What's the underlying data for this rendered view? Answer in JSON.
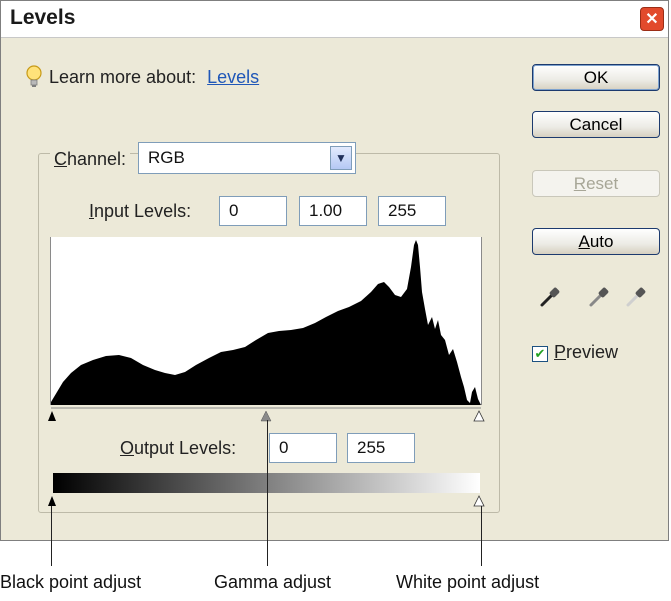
{
  "window": {
    "title": "Levels",
    "close_icon": "close-icon"
  },
  "learn": {
    "prefix": "Learn more about:",
    "link": "Levels",
    "icon": "lightbulb-icon"
  },
  "buttons": {
    "ok": "OK",
    "cancel": "Cancel",
    "reset": "Reset",
    "auto": "Auto"
  },
  "channel": {
    "label": "Channel:",
    "value": "RGB"
  },
  "input_levels": {
    "label": "Input Levels:",
    "black": "0",
    "gamma": "1.00",
    "white": "255"
  },
  "output_levels": {
    "label": "Output Levels:",
    "black": "0",
    "white": "255"
  },
  "preview": {
    "label": "Preview",
    "checked": true
  },
  "eyedroppers": [
    "black-eyedropper-icon",
    "gray-eyedropper-icon",
    "white-eyedropper-icon"
  ],
  "callouts": {
    "black": "Black point adjust",
    "gamma": "Gamma adjust",
    "white": "White point adjust"
  },
  "colors": {
    "dialog_bg": "#ece9d8",
    "link": "#1f57b8",
    "close": "#e24a2c",
    "button_border": "#1c3a6e"
  }
}
